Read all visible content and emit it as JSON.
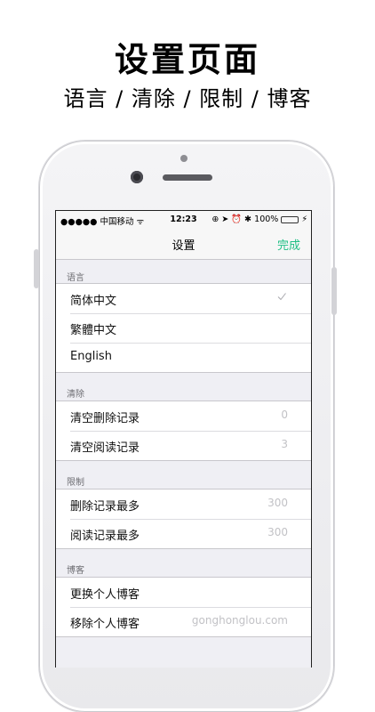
{
  "promo": {
    "title": "设置页面",
    "subtitle": "语言 / 清除 / 限制 / 博客"
  },
  "status_bar": {
    "carrier": "●●●●● 中国移动 ᯤ",
    "time": "12:23",
    "icons": "⊕ ➤ ⏰ ✱",
    "battery": "100%",
    "battery_level": 1.0,
    "battery_color": "#4cd964"
  },
  "nav": {
    "title": "设置",
    "done": "完成",
    "accent": "#1fbf85"
  },
  "sections": {
    "language": {
      "header": "语言",
      "items": [
        {
          "label": "简体中文",
          "checked": true
        },
        {
          "label": "繁體中文"
        },
        {
          "label": "English"
        }
      ]
    },
    "clear": {
      "header": "清除",
      "items": [
        {
          "label": "清空删除记录",
          "value": "0"
        },
        {
          "label": "清空阅读记录",
          "value": "3"
        }
      ]
    },
    "limit": {
      "header": "限制",
      "items": [
        {
          "label": "删除记录最多",
          "value": "300"
        },
        {
          "label": "阅读记录最多",
          "value": "300"
        }
      ]
    },
    "blog": {
      "header": "博客",
      "items": [
        {
          "label": "更换个人博客"
        },
        {
          "label": "移除个人博客",
          "value": "gonghonglou.com"
        }
      ]
    }
  }
}
